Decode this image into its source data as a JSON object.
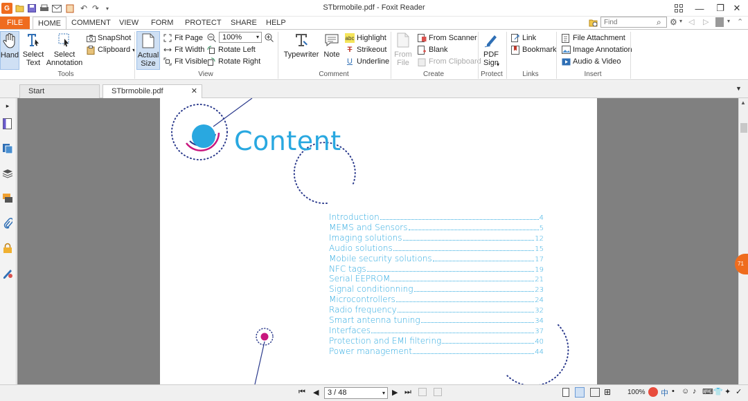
{
  "window": {
    "title": "STbrmobile.pdf - Foxit Reader"
  },
  "menu": {
    "tabs": [
      "FILE",
      "HOME",
      "COMMENT",
      "VIEW",
      "FORM",
      "PROTECT",
      "SHARE",
      "HELP"
    ]
  },
  "search": {
    "placeholder": "Find"
  },
  "ribbon": {
    "tools": {
      "hand": "Hand",
      "select_text": [
        "Select",
        "Text"
      ],
      "select_annotation": [
        "Select",
        "Annotation"
      ],
      "snapshot": "SnapShot",
      "clipboard": "Clipboard",
      "group": "Tools"
    },
    "view": {
      "actual_size": [
        "Actual",
        "Size"
      ],
      "fit_page": "Fit Page",
      "fit_width": "Fit Width",
      "fit_visible": "Fit Visible",
      "zoom": "100%",
      "rotate_left": "Rotate Left",
      "rotate_right": "Rotate Right",
      "group": "View"
    },
    "comment": {
      "typewriter": "Typewriter",
      "note": "Note",
      "highlight": "Highlight",
      "strikeout": "Strikeout",
      "underline": "Underline",
      "group": "Comment"
    },
    "create": {
      "from_file": [
        "From",
        "File"
      ],
      "from_scanner": "From Scanner",
      "blank": "Blank",
      "from_clipboard": "From Clipboard",
      "group": "Create"
    },
    "protect": {
      "pdf_sign": [
        "PDF",
        "Sign"
      ],
      "group": "Protect"
    },
    "links": {
      "link": "Link",
      "bookmark": "Bookmark",
      "group": "Links"
    },
    "insert": {
      "file_attachment": "File Attachment",
      "image_annotation": "Image Annotation",
      "audio_video": "Audio & Video",
      "group": "Insert"
    }
  },
  "tabs": {
    "start": "Start",
    "document": "STbrmobile.pdf"
  },
  "document": {
    "heading": "Content",
    "toc": [
      {
        "title": "Introduction",
        "page": "4"
      },
      {
        "title": "MEMS and Sensors",
        "page": "5"
      },
      {
        "title": "Imaging solutions",
        "page": "12"
      },
      {
        "title": "Audio solutions",
        "page": "15"
      },
      {
        "title": "Mobile security solutions",
        "page": "17"
      },
      {
        "title": "NFC tags",
        "page": "19"
      },
      {
        "title": "Serial EEPROM",
        "page": "21"
      },
      {
        "title": "Signal conditionning",
        "page": "23"
      },
      {
        "title": "Microcontrollers",
        "page": "24"
      },
      {
        "title": "Radio frequency",
        "page": "32"
      },
      {
        "title": "Smart antenna tuning",
        "page": "34"
      },
      {
        "title": "Interfaces",
        "page": "37"
      },
      {
        "title": "Protection and EMI filtering",
        "page": "40"
      },
      {
        "title": "Power management",
        "page": "44"
      }
    ]
  },
  "statusbar": {
    "page_indicator": "3 / 48",
    "zoom": "100%",
    "side_badge": "71"
  },
  "colors": {
    "file_tab": "#ef6c1e",
    "toc_blue": "#29a8e0",
    "dark_navy": "#2b3a8c",
    "magenta": "#c8177e"
  }
}
